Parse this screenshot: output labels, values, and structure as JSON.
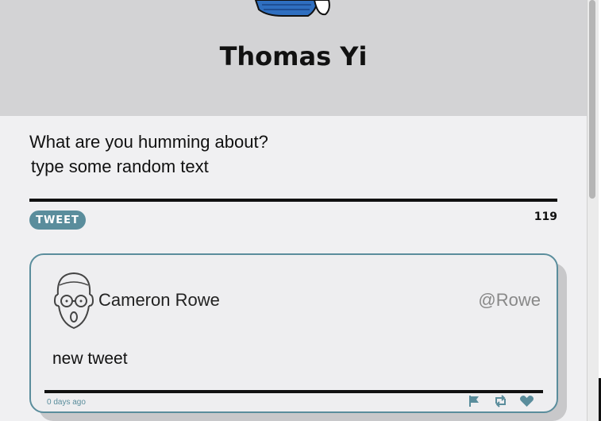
{
  "profile": {
    "name": "Thomas Yi"
  },
  "compose": {
    "prompt": "What are you humming about?",
    "value": "type some random text",
    "button_label": "TWEET",
    "counter": "119"
  },
  "tweet": {
    "author_name": "Cameron Rowe",
    "handle": "@Rowe",
    "text": "new tweet",
    "timestamp": "0 days ago",
    "actions": [
      "flag-icon",
      "retweet-icon",
      "heart-icon"
    ]
  },
  "colors": {
    "accent": "#5a8d9c",
    "header_bg": "#d3d3d5",
    "page_bg": "#f0f0f2",
    "avatar_blue": "#2f6fc0"
  }
}
